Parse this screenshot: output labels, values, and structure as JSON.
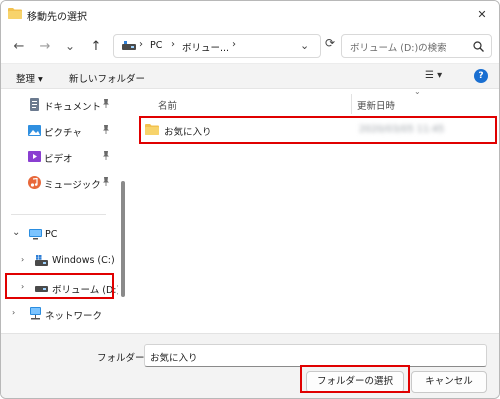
{
  "window": {
    "title": "移動先の選択",
    "close_glyph": "✕"
  },
  "nav": {
    "back_glyph": "←",
    "forward_glyph": "→",
    "recent_glyph": "⌄",
    "up_glyph": "↑",
    "breadcrumb": [
      "PC",
      "ボリュー..."
    ],
    "chevron": "›",
    "refresh_glyph": "⟳",
    "search_placeholder": "ボリューム (D:)の検索"
  },
  "toolbar": {
    "organize_label": "整理 ▾",
    "new_folder_label": "新しいフォルダー",
    "view_glyph": "☰ ▾",
    "help_glyph": "?"
  },
  "sidebar": {
    "items": [
      {
        "label": "ドキュメント",
        "pinned": true,
        "icon": "documents-icon"
      },
      {
        "label": "ピクチャ",
        "pinned": true,
        "icon": "pictures-icon"
      },
      {
        "label": "ビデオ",
        "pinned": true,
        "icon": "videos-icon"
      },
      {
        "label": "ミュージック",
        "pinned": true,
        "icon": "music-icon"
      },
      {
        "label": "PC",
        "expanded": true,
        "icon": "pc-icon"
      },
      {
        "label": "Windows (C:)",
        "icon": "drive-icon"
      },
      {
        "label": "ボリューム (D:)",
        "selected": true,
        "icon": "drive-icon"
      },
      {
        "label": "ネットワーク",
        "icon": "network-icon"
      }
    ],
    "pin_glyph": "📌",
    "expand_glyph": "›",
    "collapse_glyph": "⌄"
  },
  "file_list": {
    "columns": [
      "名前",
      "更新日時"
    ],
    "sort_glyph": "⌄",
    "rows": [
      {
        "name": "お気に入り",
        "modified": "2020/03/05 11:45",
        "type": "folder"
      }
    ]
  },
  "footer": {
    "folder_label": "フォルダー:",
    "folder_value": "お気に入り",
    "select_button": "フォルダーの選択",
    "cancel_button": "キャンセル"
  },
  "colors": {
    "highlight": "#e00000",
    "folder": "#f2c14e",
    "accent": "#1a6fd1"
  }
}
